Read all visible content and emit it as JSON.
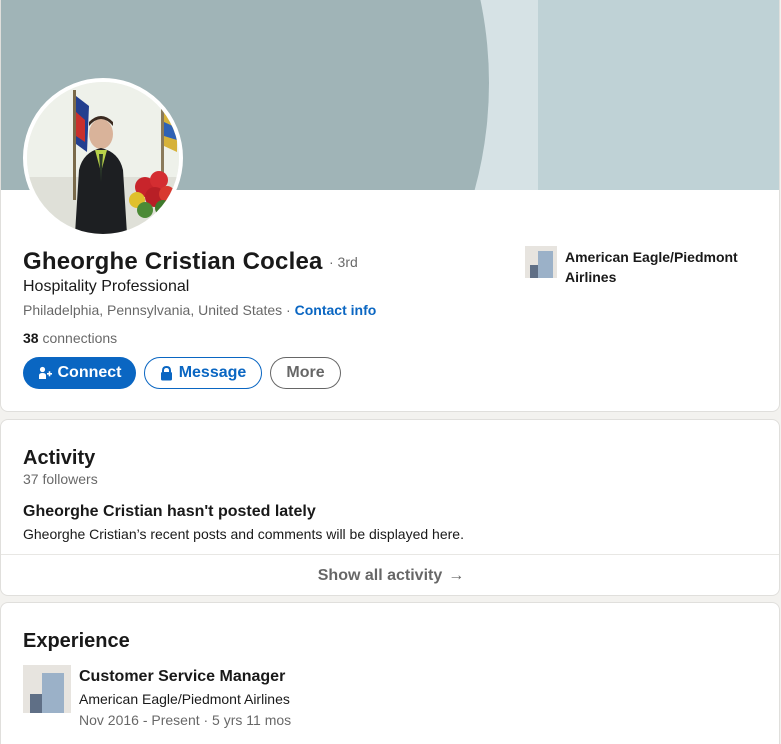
{
  "profile": {
    "name": "Gheorghe Cristian Coclea",
    "degree": "· 3rd",
    "headline": "Hospitality Professional",
    "location": "Philadelphia, Pennsylvania, United States",
    "separator": " · ",
    "contact_info": "Contact info",
    "connections_count": "38",
    "connections_label": " connections",
    "current_company": "American Eagle/Piedmont Airlines"
  },
  "actions": {
    "connect": "Connect",
    "message": "Message",
    "more": "More"
  },
  "activity": {
    "title": "Activity",
    "followers": "37 followers",
    "empty_title": "Gheorghe Cristian hasn't posted lately",
    "empty_desc": "Gheorghe Cristian’s recent posts and comments will be displayed here.",
    "show_all": "Show all activity",
    "show_all_arrow": "→"
  },
  "experience": {
    "title": "Experience",
    "items": [
      {
        "role": "Customer Service Manager",
        "company": "American Eagle/Piedmont Airlines",
        "dates": "Nov 2016 - Present · 5 yrs 11 mos"
      }
    ]
  },
  "colors": {
    "brand_blue": "#0a66c2",
    "banner_dark": "#a0b4b7",
    "banner_light": "#d6e2e5",
    "banner_panel": "#bfd2d6"
  },
  "icons": {
    "connect": "person-add-icon",
    "message": "lock-icon",
    "show_all": "arrow-right-icon"
  }
}
